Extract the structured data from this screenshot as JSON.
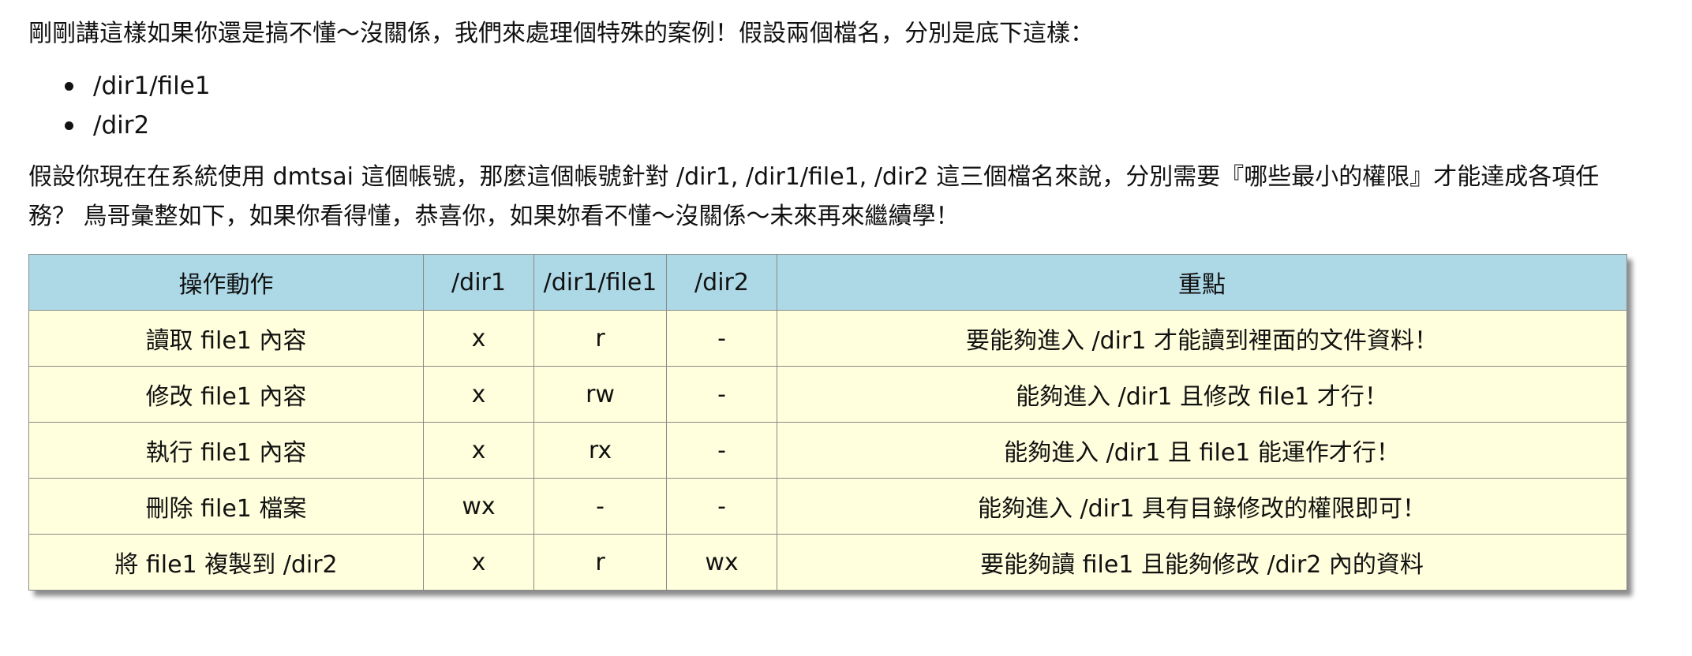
{
  "intro_text": "剛剛講這樣如果你還是搞不懂～沒關係，我們來處理個特殊的案例！假設兩個檔名，分別是底下這樣：",
  "paths": [
    "/dir1/file1",
    "/dir2"
  ],
  "description_line1": "假設你現在在系統使用 dmtsai 這個帳號，那麼這個帳號針對 /dir1, /dir1/file1, /dir2 這三個檔名來說，分別需要『哪些最小的權限』才能達成各項任",
  "description_line2": "務？ 鳥哥彙整如下，如果你看得懂，恭喜你，如果妳看不懂～沒關係～未來再來繼續學！",
  "table": {
    "headers": [
      "操作動作",
      "/dir1",
      "/dir1/file1",
      "/dir2",
      "重點"
    ],
    "rows": [
      [
        "讀取 file1 內容",
        "x",
        "r",
        "-",
        "要能夠進入 /dir1 才能讀到裡面的文件資料！"
      ],
      [
        "修改 file1 內容",
        "x",
        "rw",
        "-",
        "能夠進入 /dir1 且修改 file1 才行！"
      ],
      [
        "執行 file1 內容",
        "x",
        "rx",
        "-",
        "能夠進入 /dir1 且 file1 能運作才行！"
      ],
      [
        "刪除 file1 檔案",
        "wx",
        "-",
        "-",
        "能夠進入 /dir1 具有目錄修改的權限即可！"
      ],
      [
        "將 file1 複製到 /dir2",
        "x",
        "r",
        "wx",
        "要能夠讀 file1 且能夠修改 /dir2 內的資料"
      ]
    ]
  },
  "colors": {
    "header_bg": "#add8e6",
    "row_bg": "#ffffdd",
    "border": "#8a8a8a"
  }
}
